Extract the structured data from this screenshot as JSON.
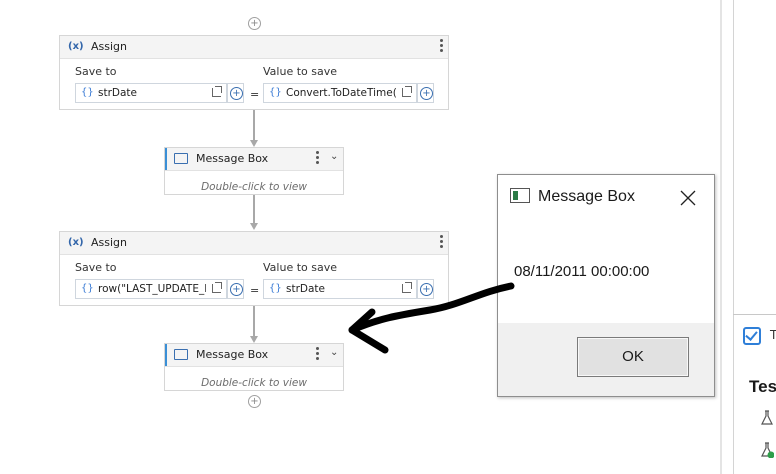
{
  "workflow": {
    "assign1": {
      "title": "Assign",
      "save_to_label": "Save to",
      "value_to_save_label": "Value to save",
      "save_to_value": "strDate",
      "value_value": "Convert.ToDateTime(ro",
      "equals": "="
    },
    "msgbox1": {
      "title": "Message Box",
      "hint": "Double-click to view"
    },
    "assign2": {
      "title": "Assign",
      "save_to_label": "Save to",
      "value_to_save_label": "Value to save",
      "save_to_value": "row(\"LAST_UPDATE_D/",
      "value_value": "strDate",
      "equals": "="
    },
    "msgbox2": {
      "title": "Message Box",
      "hint": "Double-click to view"
    },
    "brace_symbol": "{}",
    "assign_symbol": "(x)"
  },
  "dialog": {
    "title": "Message Box",
    "message": "08/11/2011 00:00:00",
    "ok_label": "OK"
  },
  "right_panel": {
    "tab_partial": "T",
    "heading_partial": "Tes"
  },
  "colors": {
    "accent": "#3a8fd6",
    "checkbox": "#2f7fd8",
    "connector": "#a8a8a8"
  }
}
